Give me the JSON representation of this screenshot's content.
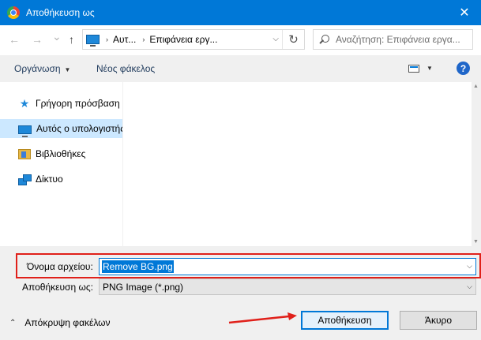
{
  "window": {
    "title": "Αποθήκευση ως",
    "close_glyph": "✕"
  },
  "nav": {
    "back_glyph": "←",
    "forward_glyph": "→",
    "recent_glyph": "⌄",
    "up_glyph": "↑",
    "breadcrumb": [
      "Αυτ...",
      "Επιφάνεια εργ..."
    ],
    "crumb_separator": "›",
    "refresh_glyph": "↻",
    "search_placeholder": "Αναζήτηση: Επιφάνεια εργα..."
  },
  "toolbar": {
    "organize_label": "Οργάνωση",
    "new_folder_label": "Νέος φάκελος",
    "help_glyph": "?"
  },
  "sidebar": {
    "items": [
      {
        "label": "Γρήγορη πρόσβαση",
        "icon": "star-icon",
        "selected": false
      },
      {
        "label": "Αυτός ο υπολογιστής",
        "icon": "computer-icon",
        "selected": true
      },
      {
        "label": "Βιβλιοθήκες",
        "icon": "libraries-icon",
        "selected": false
      },
      {
        "label": "Δίκτυο",
        "icon": "network-icon",
        "selected": false
      }
    ]
  },
  "form": {
    "filename_label": "Όνομα αρχείου:",
    "filename_value": "Remove BG.png",
    "type_label": "Αποθήκευση ως:",
    "type_value": "PNG Image (*.png)"
  },
  "footer": {
    "hide_folders_label": "Απόκρυψη φακέλων",
    "save_label": "Αποθήκευση",
    "cancel_label": "Άκυρο"
  },
  "colors": {
    "titlebar": "#0078d7",
    "annotation": "#e0201a",
    "selection": "#cce8ff"
  }
}
